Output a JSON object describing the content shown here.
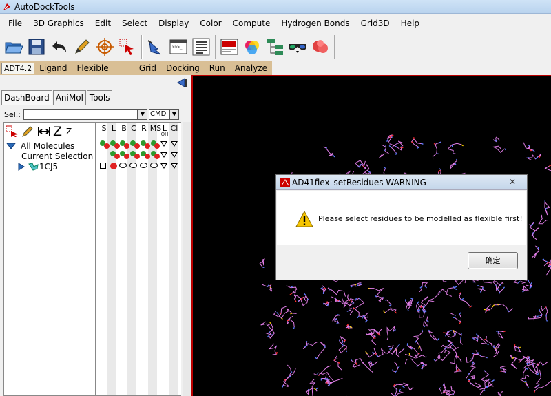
{
  "window": {
    "title": "AutoDockTools"
  },
  "menubar": {
    "items": [
      "File",
      "3D Graphics",
      "Edit",
      "Select",
      "Display",
      "Color",
      "Compute",
      "Hydrogen Bonds",
      "Grid3D",
      "Help"
    ]
  },
  "adt_tabs": {
    "items": [
      "ADT4.2",
      "Ligand",
      "Flexible Residues",
      "Grid",
      "Docking",
      "Run",
      "Analyze"
    ]
  },
  "dashboard": {
    "tabs": [
      "DashBoard",
      "AniMol",
      "Tools"
    ],
    "sel_label": "Sel.:",
    "sel_value": "",
    "cmd_label": "CMD",
    "tree_tool_z1": "Z",
    "tree_tool_z2": "Z",
    "tree": {
      "all_molecules": "All Molecules",
      "current_selection": "Current Selection",
      "molecule": "1CJ5"
    },
    "columns": [
      {
        "head": "S",
        "sub": ""
      },
      {
        "head": "L",
        "sub": ""
      },
      {
        "head": "B",
        "sub": ""
      },
      {
        "head": "C",
        "sub": ""
      },
      {
        "head": "R",
        "sub": ""
      },
      {
        "head": "MS",
        "sub": ""
      },
      {
        "head": "L",
        "sub": "OH"
      },
      {
        "head": "Cl",
        "sub": ""
      }
    ]
  },
  "dialog": {
    "title": "AD41flex_setResidues WARNING",
    "close": "✕",
    "message": "Please select residues to be modelled as flexible first!",
    "ok_label": "确定"
  },
  "colors": {
    "viewer_bg": "#000000",
    "molecule_pink": "#e07de6",
    "molecule_blue": "#5c7cff",
    "molecule_red": "#ff3030",
    "molecule_yellow": "#ffd400",
    "adt_bar": "#d9bf95",
    "dot_red": "#e02020",
    "dot_green": "#2e9a2e"
  }
}
